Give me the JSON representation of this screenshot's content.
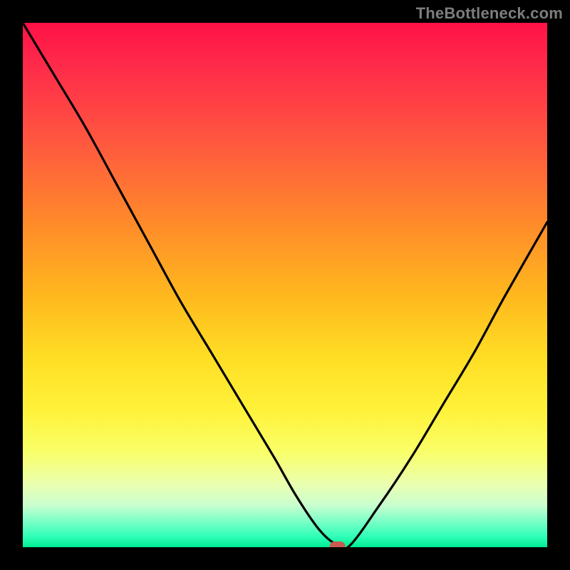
{
  "watermark": {
    "text": "TheBottleneck.com"
  },
  "colors": {
    "background": "#000000",
    "curve": "#000000",
    "marker": "#c75a52",
    "gradient_top": "#ff1147",
    "gradient_bottom": "#00ec93"
  },
  "chart_data": {
    "type": "line",
    "title": "",
    "xlabel": "",
    "ylabel": "",
    "xlim": [
      0,
      100
    ],
    "ylim": [
      0,
      100
    ],
    "grid": false,
    "legend": false,
    "annotations": [
      "TheBottleneck.com"
    ],
    "x": [
      0,
      6,
      12,
      18,
      24,
      30,
      36,
      42,
      48,
      52,
      56,
      59,
      62,
      68,
      74,
      80,
      86,
      92,
      100
    ],
    "values": [
      100,
      90,
      80,
      69,
      58,
      47,
      37,
      27,
      17,
      10,
      4,
      1,
      0,
      8,
      17,
      27,
      37,
      48,
      62
    ],
    "flat_segment_x": [
      56,
      62
    ],
    "marker": {
      "x": 60,
      "y": 0
    },
    "note": "Values estimated from pixel positions; no axis ticks or numeric labels are shown in the image."
  }
}
